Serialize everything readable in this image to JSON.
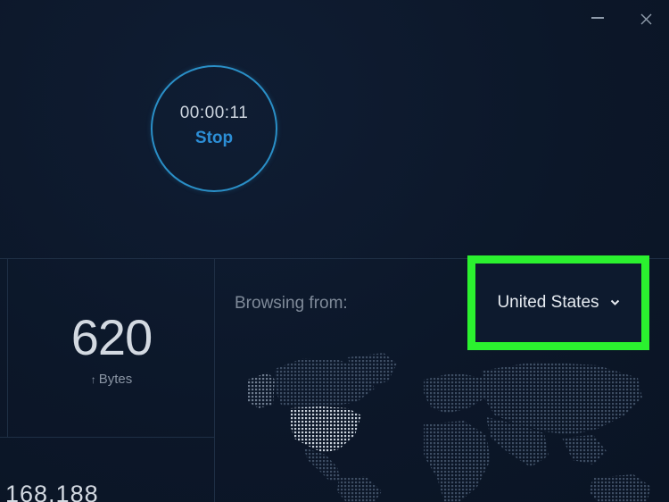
{
  "window": {
    "minimize_icon": "minimize-icon",
    "close_icon": "close-icon"
  },
  "timer": {
    "elapsed": "00:00:11",
    "action_label": "Stop"
  },
  "stats": {
    "upload_value": "620",
    "upload_unit": "Bytes",
    "upload_icon": "arrow-up-icon",
    "download_value": "168,188"
  },
  "location": {
    "label": "Browsing from:",
    "selected_country": "United States",
    "dropdown_icon": "chevron-down-icon"
  },
  "colors": {
    "background": "#0c1729",
    "accent": "#2c8ed6",
    "highlight": "#2bf12f"
  }
}
